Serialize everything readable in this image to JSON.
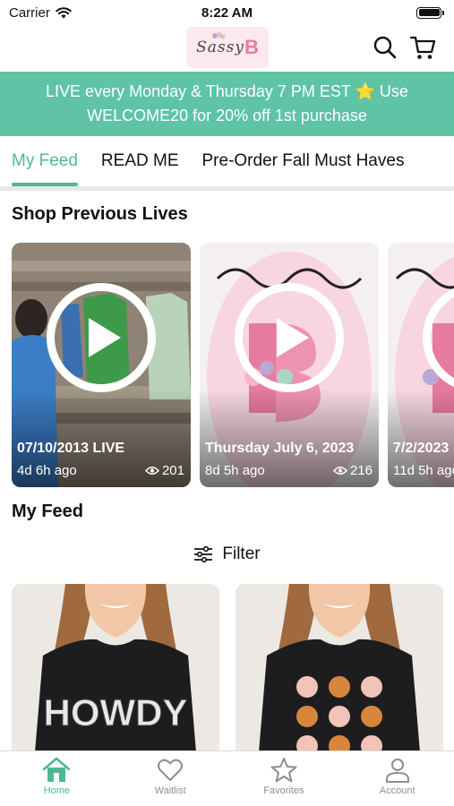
{
  "status_bar": {
    "carrier": "Carrier",
    "time": "8:22 AM"
  },
  "header": {
    "logo_text": "Sassy",
    "logo_letter": "B",
    "icons": [
      "search-icon",
      "cart-icon"
    ]
  },
  "promo": {
    "text": "LIVE every Monday & Thursday 7 PM EST ⭐ Use WELCOME20 for 20% off 1st purchase"
  },
  "tabs": [
    {
      "label": "My Feed",
      "active": true
    },
    {
      "label": "READ ME",
      "active": false
    },
    {
      "label": "Pre-Order Fall Must Haves",
      "active": false
    }
  ],
  "previous_lives": {
    "title": "Shop Previous Lives",
    "items": [
      {
        "title": "07/10/2013 LIVE",
        "ago": "4d 6h ago",
        "views": "201"
      },
      {
        "title": "Thursday July 6, 2023",
        "ago": "8d 5h ago",
        "views": "216"
      },
      {
        "title": "7/2/2023",
        "ago": "11d 5h ago",
        "views": ""
      }
    ]
  },
  "feed": {
    "title": "My Feed",
    "filter_label": "Filter",
    "products": [
      {
        "graphic_text": "HOWDY"
      },
      {
        "graphic_text": ""
      }
    ]
  },
  "bottom_nav": [
    {
      "label": "Home",
      "icon": "home-icon",
      "active": true
    },
    {
      "label": "Waitlist",
      "icon": "heart-icon",
      "active": false
    },
    {
      "label": "Favorites",
      "icon": "star-icon",
      "active": false
    },
    {
      "label": "Account",
      "icon": "person-icon",
      "active": false
    }
  ],
  "colors": {
    "accent": "#4fb794",
    "promo_bg": "#5fc3a5",
    "inactive_nav": "#8e8e93"
  }
}
